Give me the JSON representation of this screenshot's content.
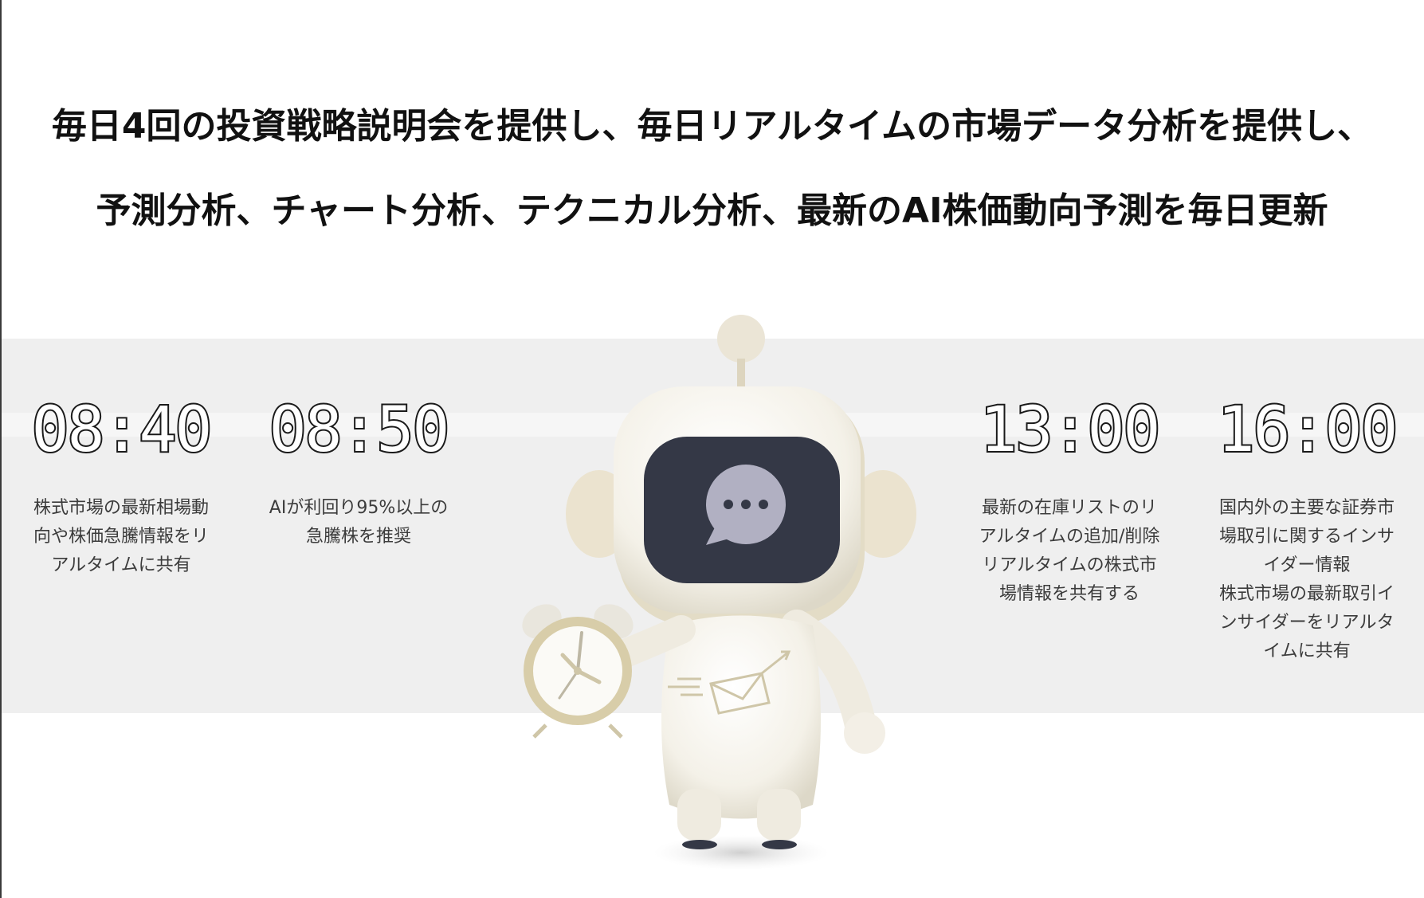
{
  "headline": {
    "line1": "毎日4回の投資戦略説明会を提供し、毎日リアルタイムの市場データ分析を提供し、",
    "line2": "予測分析、チャート分析、テクニカル分析、最新のAI株価動向予測を毎日更新"
  },
  "schedule": [
    {
      "time": "08:40",
      "description": "株式市場の最新相場動\n向や株価急騰情報をリ\nアルタイムに共有"
    },
    {
      "time": "08:50",
      "description": "AIが利回り95%以上の\n急騰株を推奨"
    },
    {
      "time": "13:00",
      "description": "最新の在庫リストのリ\nアルタイムの追加/削除\nリアルタイムの株式市\n場情報を共有する"
    },
    {
      "time": "16:00",
      "description": "国内外の主要な証券市\n場取引に関するインサ\nイダー情報\n株式市場の最新取引イ\nンサイダーをリアルタ\nイムに共有"
    }
  ],
  "colors": {
    "band": "#efefef",
    "robot_screen": "#343846",
    "robot_body": "#f5f2e8",
    "robot_accent": "#e9e2d2",
    "clock_rim": "#d8cda9"
  },
  "icons": [
    "robot-mascot",
    "chat-bubble-icon",
    "alarm-clock-icon",
    "envelope-icon"
  ]
}
